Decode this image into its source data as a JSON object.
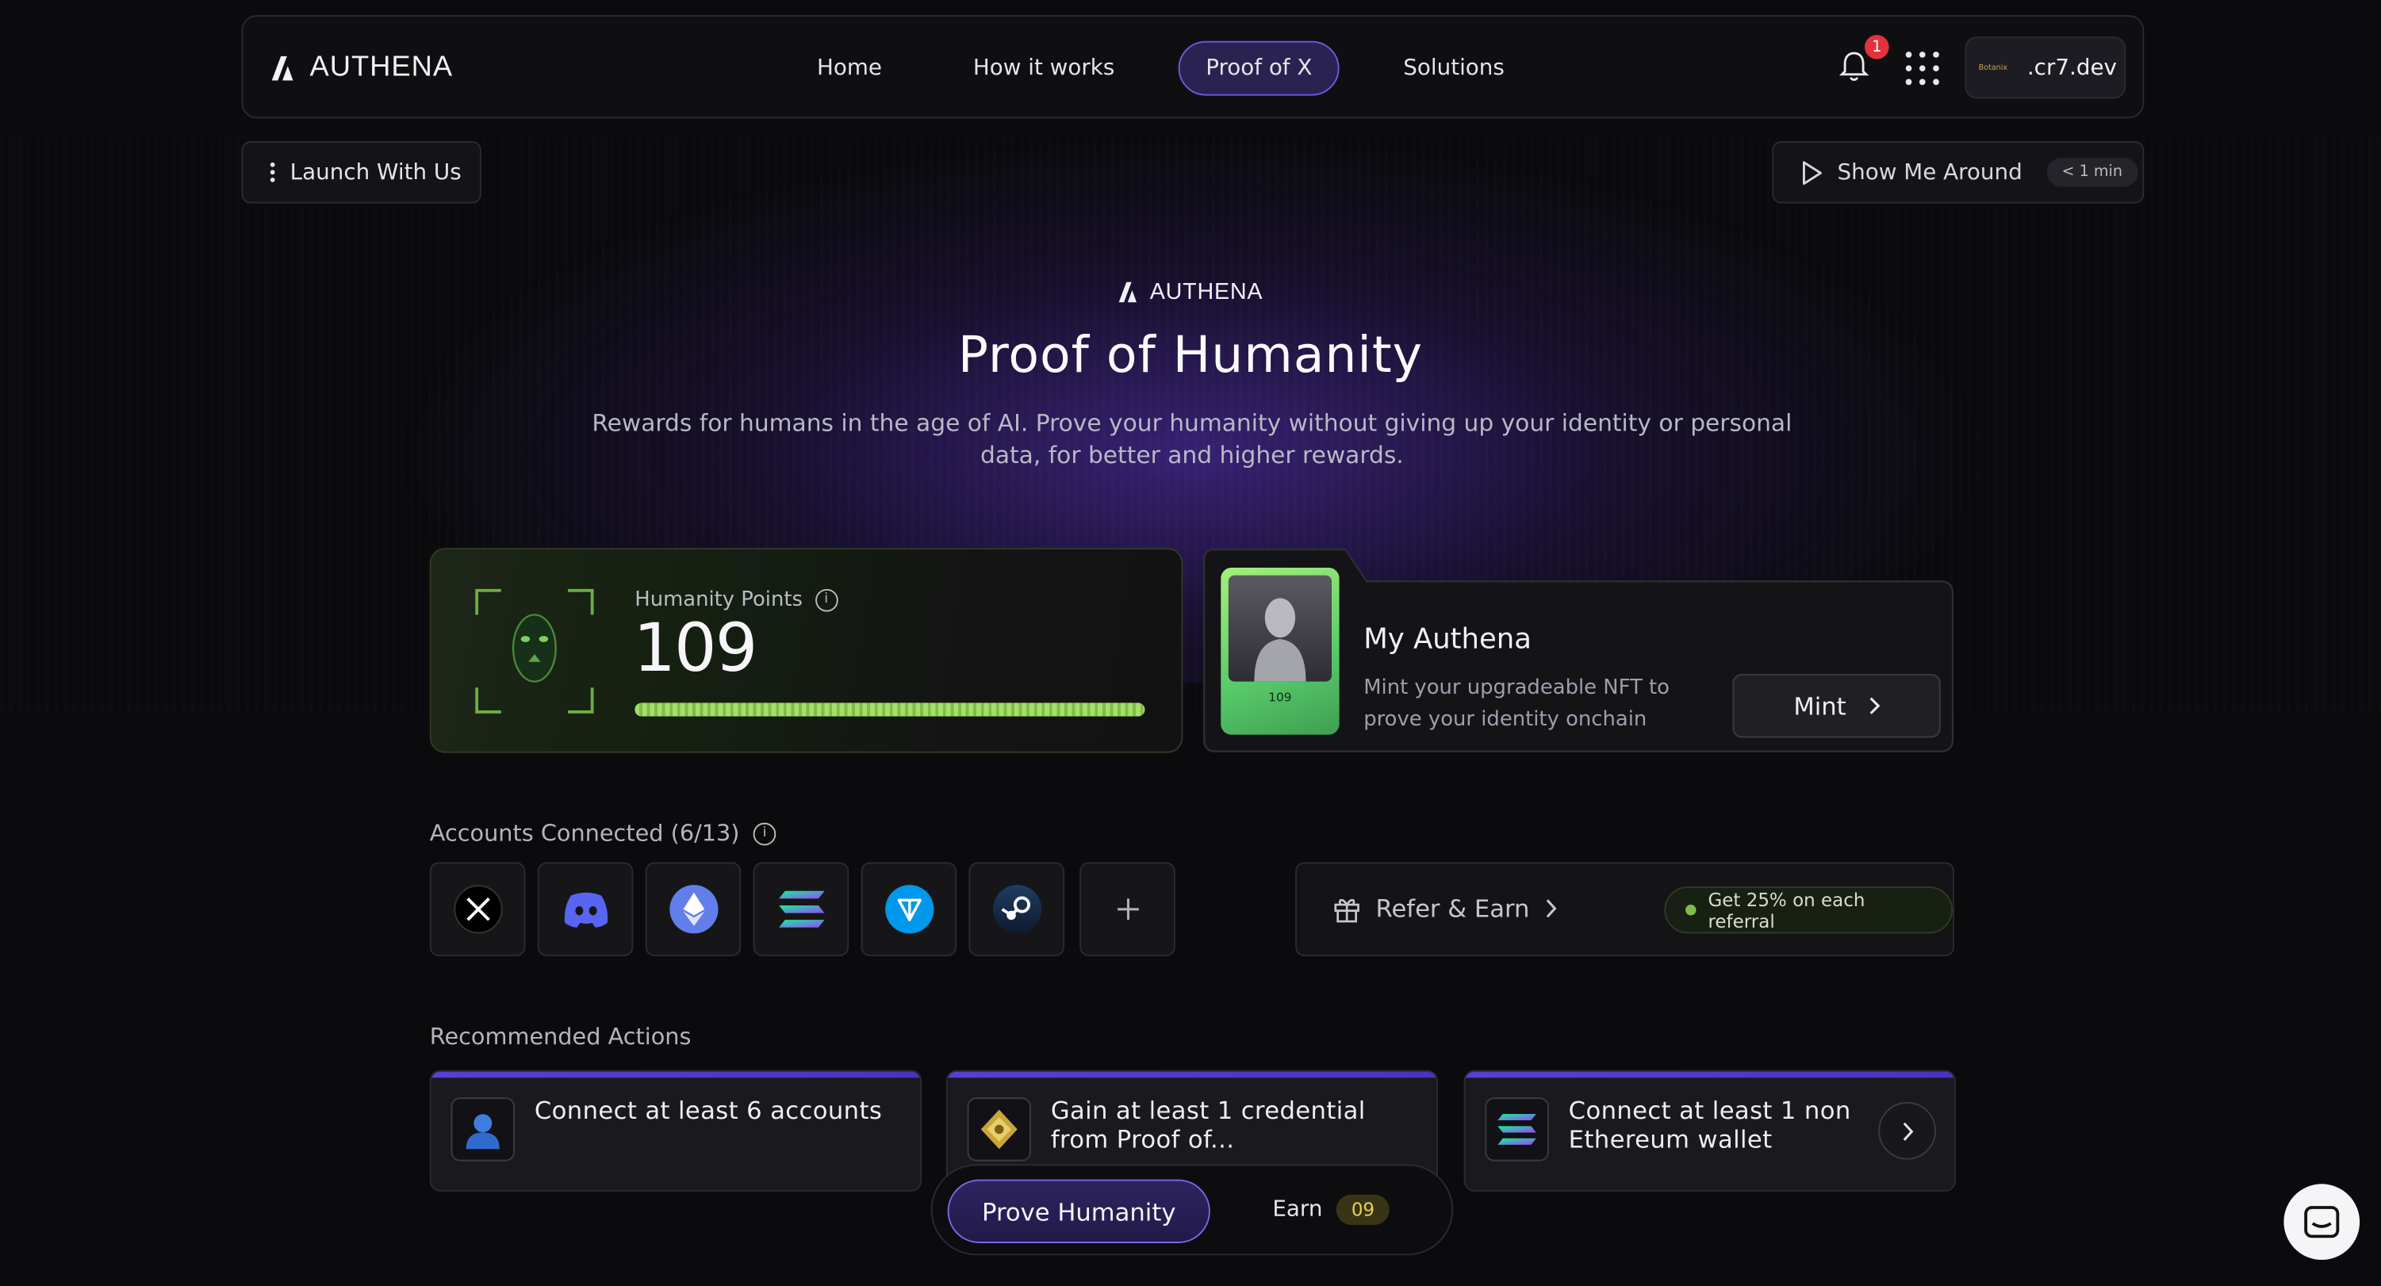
{
  "brand": {
    "name": "AUTHENA"
  },
  "nav": {
    "links": [
      "Home",
      "How it works",
      "Proof of X",
      "Solutions"
    ],
    "active_index": 2,
    "notification_count": "1",
    "account_name": ".cr7.dev",
    "account_chip": "Botanix"
  },
  "actions": {
    "launch_label": "Launch With Us",
    "tour_label": "Show Me Around",
    "tour_duration": "< 1 min"
  },
  "hero": {
    "brand": "AUTHENA",
    "title": "Proof of Humanity",
    "subtitle": "Rewards for humans in the age of AI. Prove your humanity without giving up your identity or personal data, for better and higher rewards."
  },
  "points": {
    "label": "Humanity Points",
    "value": "109",
    "progress_fraction": 1.0
  },
  "nft": {
    "title": "My Authena",
    "description": "Mint your upgradeable NFT to prove your identity onchain",
    "mint_label": "Mint",
    "card_number": "109"
  },
  "accounts": {
    "title": "Accounts Connected (6/13)",
    "items": [
      {
        "name": "x-icon",
        "color": "#000000"
      },
      {
        "name": "discord-icon",
        "color": "#5865F2"
      },
      {
        "name": "ethereum-icon",
        "color": "#627EEA"
      },
      {
        "name": "solana-icon",
        "color": "#14F195"
      },
      {
        "name": "ton-icon",
        "color": "#0098EA"
      },
      {
        "name": "steam-icon",
        "color": "#1B2838"
      },
      {
        "name": "add-icon",
        "color": "#9a9aa6"
      }
    ]
  },
  "refer": {
    "label": "Refer & Earn",
    "pill": "Get 25% on each referral"
  },
  "recommended": {
    "title": "Recommended Actions",
    "items": [
      {
        "text": "Connect at least 6 accounts"
      },
      {
        "text": "Gain at least 1 credential from Proof of..."
      },
      {
        "text": "Connect at least 1 non Ethereum wallet"
      }
    ]
  },
  "dock": {
    "prove_label": "Prove Humanity",
    "earn_label": "Earn",
    "earn_count": "09"
  },
  "colors": {
    "accent_purple": "#6d5be0",
    "points_green": "#a5de6a",
    "badge_red": "#e2323c"
  }
}
